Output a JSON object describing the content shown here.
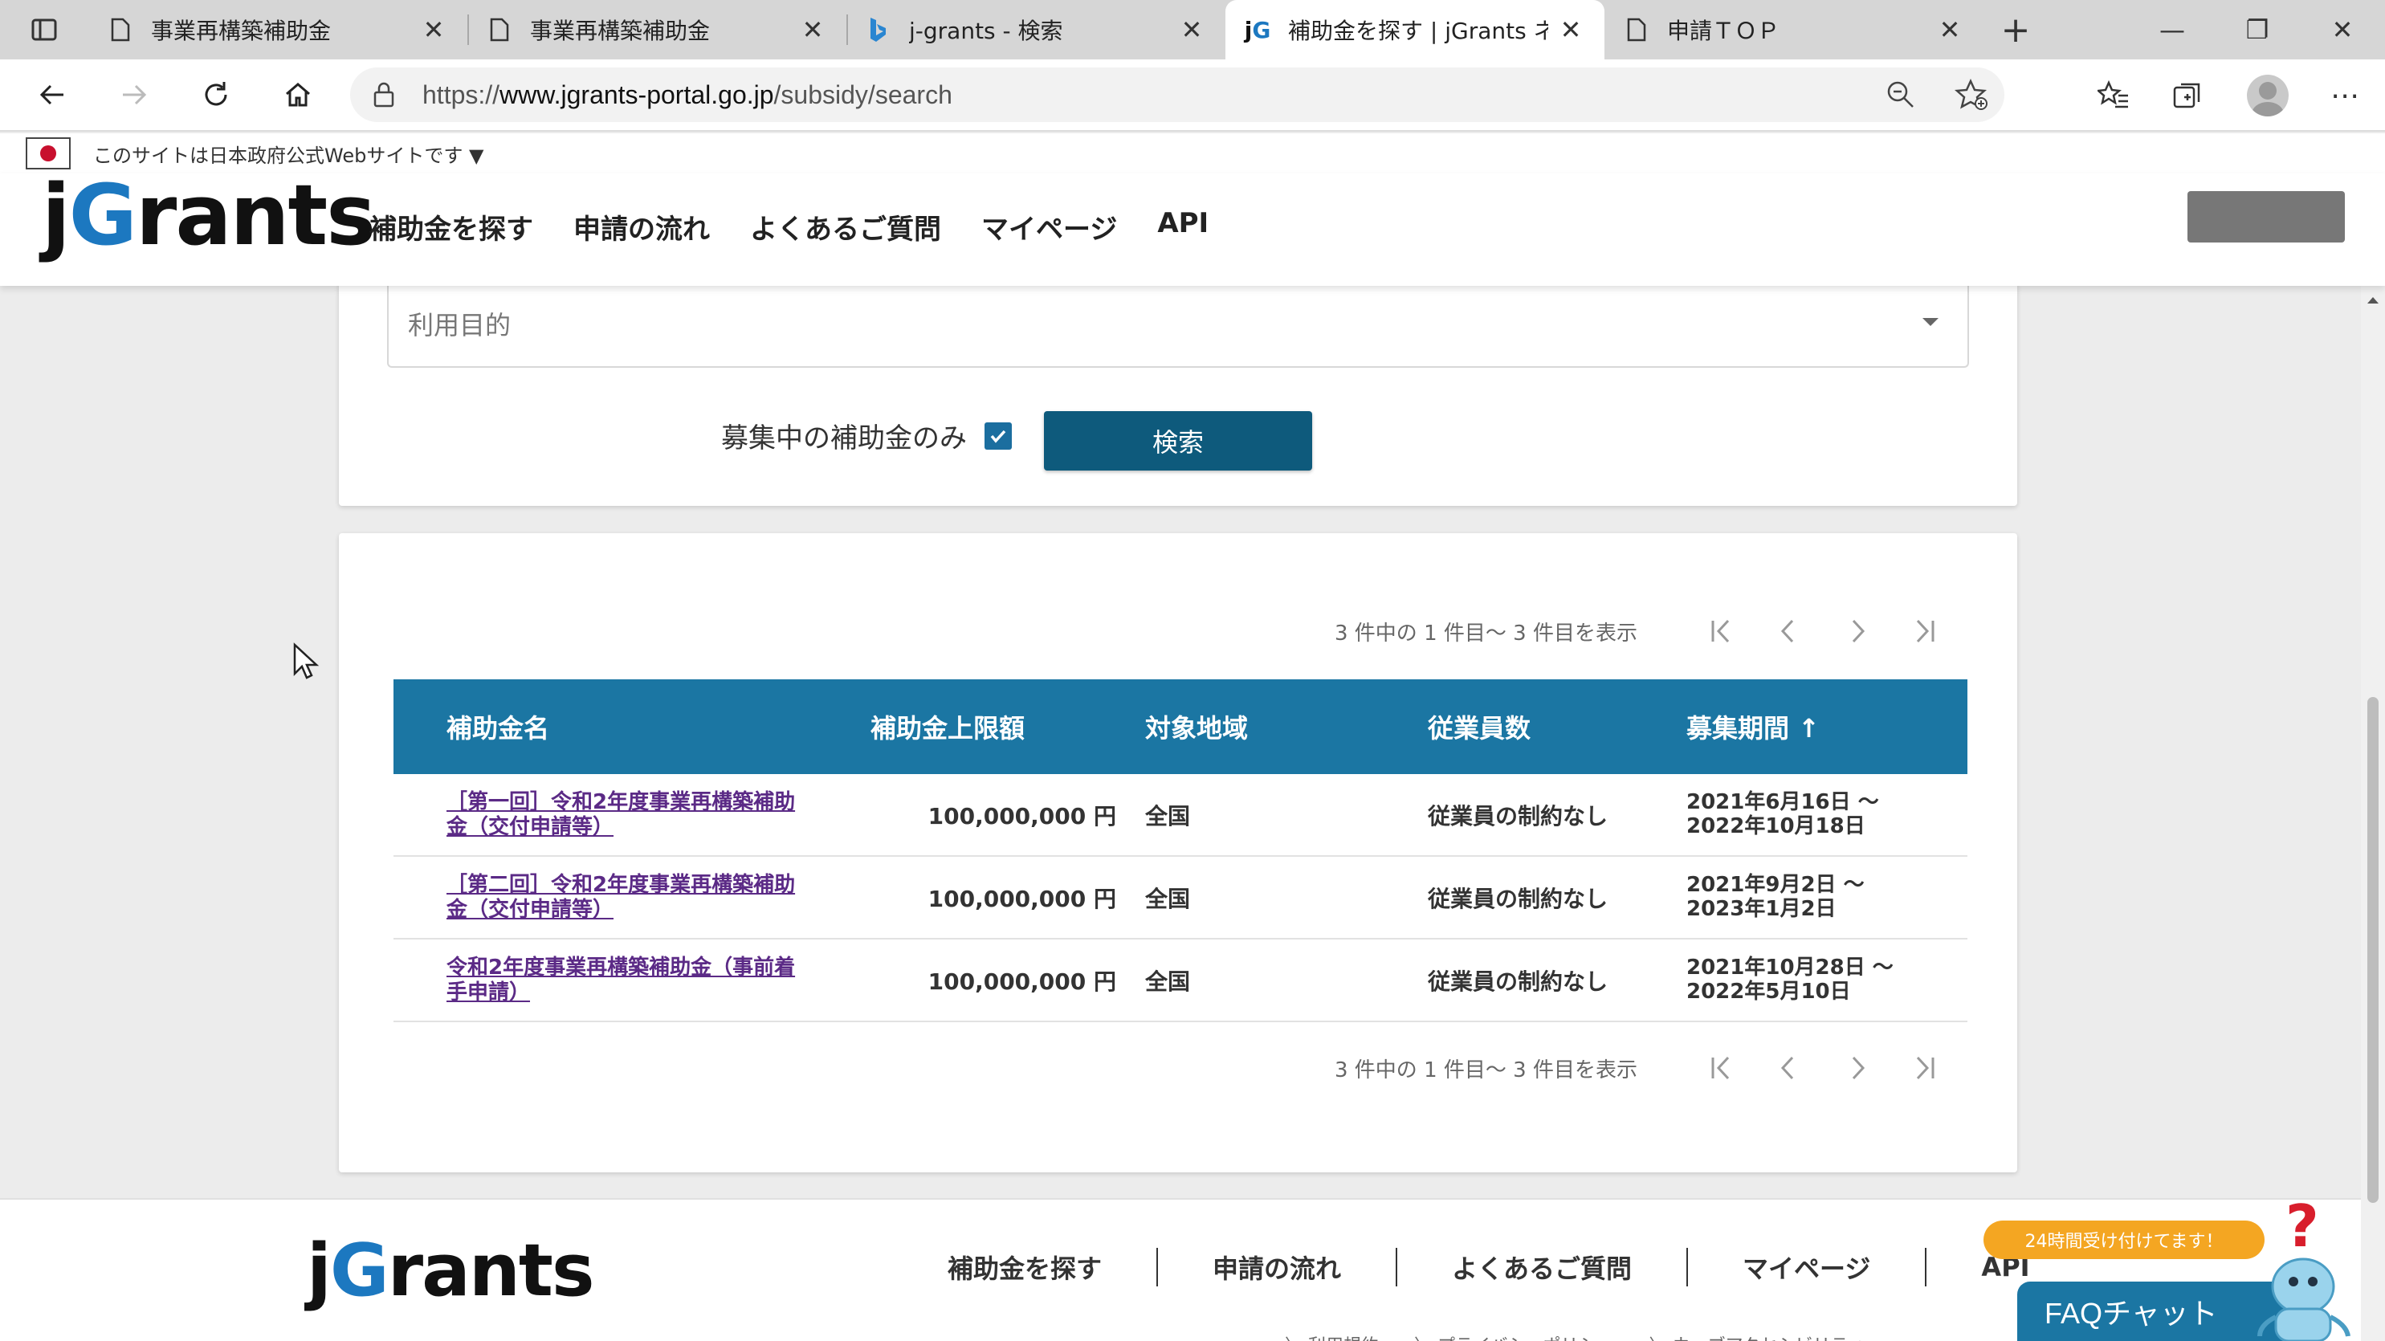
{
  "browser": {
    "tabs": [
      {
        "title": "事業再構築補助金",
        "icon": "page-icon",
        "active": false
      },
      {
        "title": "事業再構築補助金",
        "icon": "page-icon",
        "active": false
      },
      {
        "title": "j-grants - 検索",
        "icon": "bing-icon",
        "active": false
      },
      {
        "title": "補助金を探す | jGrants ネッ",
        "icon": "jg-icon",
        "active": true
      },
      {
        "title": "申請ＴＯＰ",
        "icon": "page-icon",
        "active": false
      }
    ],
    "url_prefix": "https://",
    "url_host": "www.jgrants-portal.go.jp",
    "url_path": "/subsidy/search"
  },
  "site": {
    "gov_notice": "このサイトは日本政府公式Webサイトです ▼",
    "logo_j": "j",
    "logo_g": "G",
    "logo_rest": "rants",
    "nav": [
      "補助金を探す",
      "申請の流れ",
      "よくあるご質問",
      "マイページ",
      "API"
    ]
  },
  "search": {
    "purpose_placeholder": "利用目的",
    "only_open_label": "募集中の補助金のみ",
    "only_open_checked": true,
    "search_button": "検索"
  },
  "results": {
    "pager_info": "3 件中の 1 件目～ 3 件目を表示",
    "columns": [
      "補助金名",
      "補助金上限額",
      "対象地域",
      "従業員数",
      "募集期間 ↑"
    ],
    "rows": [
      {
        "name_line1": "［第一回］令和2年度事業再構築補助",
        "name_line2": "金（交付申請等）",
        "amount": "100,000,000 円",
        "region": "全国",
        "employees": "従業員の制約なし",
        "period_line1": "2021年6月16日 ～",
        "period_line2": "2022年10月18日"
      },
      {
        "name_line1": "［第二回］令和2年度事業再構築補助",
        "name_line2": "金（交付申請等）",
        "amount": "100,000,000 円",
        "region": "全国",
        "employees": "従業員の制約なし",
        "period_line1": "2021年9月2日 ～",
        "period_line2": "2023年1月2日"
      },
      {
        "name_line1": "令和2年度事業再構築補助金（事前着",
        "name_line2": "手申請）",
        "amount": "100,000,000 円",
        "region": "全国",
        "employees": "従業員の制約なし",
        "period_line1": "2021年10月28日 ～",
        "period_line2": "2022年5月10日"
      }
    ]
  },
  "footer": {
    "nav": [
      "補助金を探す",
      "申請の流れ",
      "よくあるご質問",
      "マイページ",
      "API"
    ],
    "links": "〉 利用規約　　〉 プライバシーポリシー　　〉 ウェブアクセシビリティ",
    "chat_bubble": "24時間受け付けてます！",
    "chat_button": "FAQチャット"
  },
  "colors": {
    "table_header": "#1b76a3",
    "search_button": "#0e5a7c",
    "link_visited": "#5b2a86",
    "chat_bubble": "#f4a622",
    "logo_accent": "#1c78c0"
  }
}
